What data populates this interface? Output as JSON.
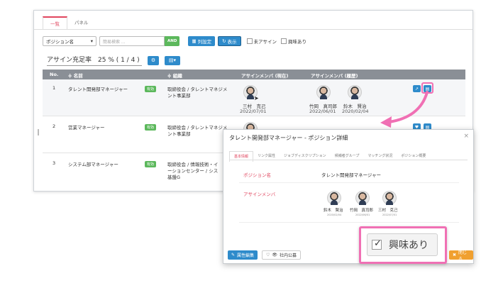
{
  "tabs": [
    {
      "label": "一覧",
      "active": true
    },
    {
      "label": "パネル",
      "active": false
    }
  ],
  "filter": {
    "select_value": "ポジション名",
    "search_placeholder": "簡易検索 ...",
    "and_label": "AND",
    "column_settings_label": "列設定",
    "display_label": "表示",
    "unassigned_label": "未アサイン",
    "interested_label": "興味あり"
  },
  "rate": {
    "text": "アサイン充足率　25 % ( 1 / 4 )"
  },
  "table": {
    "headers": {
      "no": "No.",
      "name": "≑ 名前",
      "org": "≑ 組織",
      "current": "アサインメンバ (現在)",
      "history": "アサインメンバ (履歴)"
    },
    "rows": [
      {
        "no": "1",
        "name": "タレント開発部マネージャー",
        "badge": "有効",
        "org_line1": "取締役会 / タレントマネジメ",
        "org_line2": "ント事業部",
        "current": [
          {
            "name": "三村　克己",
            "date": "2022/07/01"
          }
        ],
        "history": [
          {
            "name": "竹岡　真司郎",
            "date": "2022/06/01"
          },
          {
            "name": "鈴木　賢治",
            "date": "2020/02/04"
          }
        ]
      },
      {
        "no": "2",
        "name": "営業マネージャー",
        "badge": "有効",
        "org_line1": "取締役会 / タレントマネジメ",
        "org_line2": "ント事業部"
      },
      {
        "no": "3",
        "name": "システム部マネージャー",
        "badge": "有効",
        "org_line1": "取締役会 / 情報技術・イ",
        "org_line2": "ーションセンター / シス",
        "org_line3": "基盤G"
      }
    ]
  },
  "modal": {
    "title": "タレント開発部マネージャー - ポジション詳細",
    "close": "×",
    "tabs": [
      "基本情報",
      "リンク属性",
      "ジョブディスクリプション",
      "候補者グループ",
      "マッチング状況",
      "ポジション概要"
    ],
    "position_label": "ポジション名",
    "position_value": "タレント開発部マネージャー",
    "members_label": "アサインメンバ",
    "members": [
      {
        "name": "鈴木　賢治",
        "date": "2020/02/04"
      },
      {
        "name": "竹岡　真司郎",
        "date": "2022/06/01"
      },
      {
        "name": "三村　克己",
        "date": "2022/07/01"
      }
    ],
    "edit_label": "属性編集",
    "publish_label": "社内公募",
    "close_label": "閉じる"
  },
  "interest": {
    "label": "興味あり"
  },
  "colors": {
    "accent_pink": "#f070b4",
    "primary_blue": "#2e8bcb",
    "badge_green": "#5cb85c",
    "close_orange": "#f0a030"
  }
}
